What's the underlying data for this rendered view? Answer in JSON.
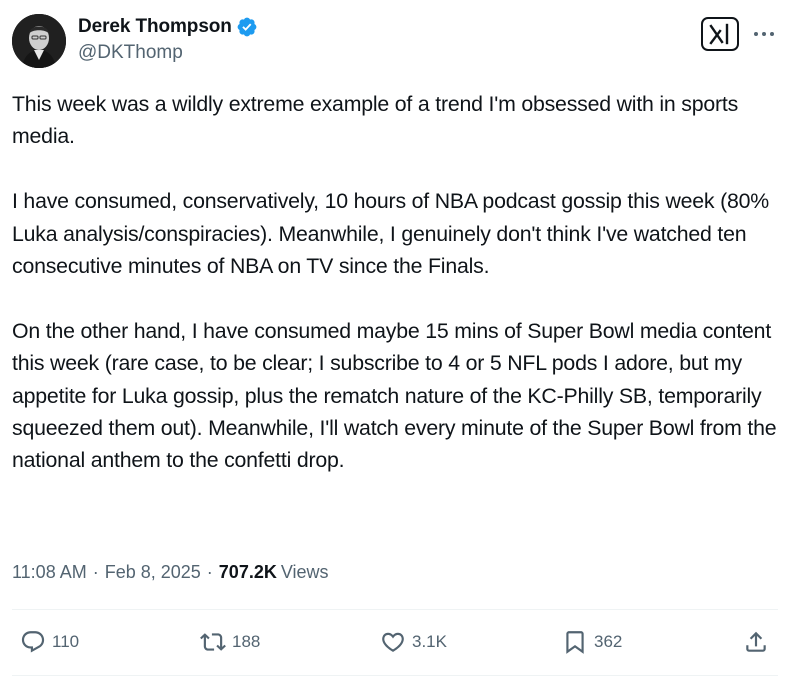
{
  "author": {
    "display_name": "Derek Thompson",
    "handle": "@DKThomp"
  },
  "tweet": {
    "text": "This week was a wildly extreme example of a trend I'm obsessed with in sports media.\n\nI have consumed, conservatively, 10 hours of NBA podcast gossip this week (80% Luka analysis/conspiracies). Meanwhile, I genuinely don't think I've watched ten consecutive minutes of NBA on TV since the Finals.\n\nOn the other hand, I have consumed maybe 15 mins of Super Bowl media content this week (rare case, to be clear; I subscribe to 4 or 5 NFL pods I adore, but my appetite for Luka gossip, plus the rematch nature of the KC-Philly SB, temporarily squeezed them out). Meanwhile, I'll watch every minute of the Super Bowl from the national anthem to the confetti drop."
  },
  "meta": {
    "time": "11:08 AM",
    "separator": "·",
    "date": "Feb 8, 2025",
    "views_count": "707.2K",
    "views_label": "Views"
  },
  "actions": {
    "replies": "110",
    "reposts": "188",
    "likes": "3.1K",
    "bookmarks": "362"
  },
  "icons": {
    "verified": "verified-badge-icon",
    "grok": "grok-icon",
    "more": "more-icon",
    "reply": "reply-icon",
    "repost": "repost-icon",
    "like": "heart-icon",
    "bookmark": "bookmark-icon",
    "share": "share-icon"
  },
  "colors": {
    "verified": "#1d9bf0",
    "text": "#0f1419",
    "secondary": "#536471"
  }
}
